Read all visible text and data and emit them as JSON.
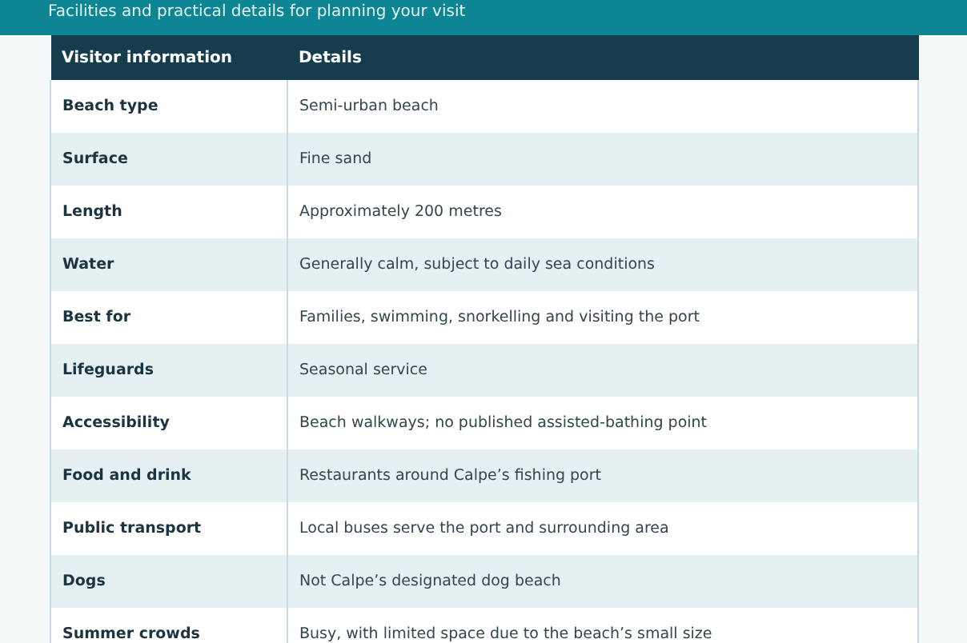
{
  "header": {
    "subtitle": "Facilities and practical details for planning your visit"
  },
  "table": {
    "columns": [
      "Visitor information",
      "Details"
    ],
    "rows": [
      {
        "label": "Beach type",
        "value": "Semi-urban beach"
      },
      {
        "label": "Surface",
        "value": "Fine sand"
      },
      {
        "label": "Length",
        "value": "Approximately 200 metres"
      },
      {
        "label": "Water",
        "value": "Generally calm, subject to daily sea conditions"
      },
      {
        "label": "Best for",
        "value": "Families, swimming, snorkelling and visiting the port"
      },
      {
        "label": "Lifeguards",
        "value": "Seasonal service"
      },
      {
        "label": "Accessibility",
        "value": "Beach walkways; no published assisted-bathing point"
      },
      {
        "label": "Food and drink",
        "value": "Restaurants around Calpe’s fishing port"
      },
      {
        "label": "Public transport",
        "value": "Local buses serve the port and surrounding area"
      },
      {
        "label": "Dogs",
        "value": "Not Calpe’s designated dog beach"
      },
      {
        "label": "Summer crowds",
        "value": "Busy, with limited space due to the beach’s small size"
      }
    ]
  }
}
